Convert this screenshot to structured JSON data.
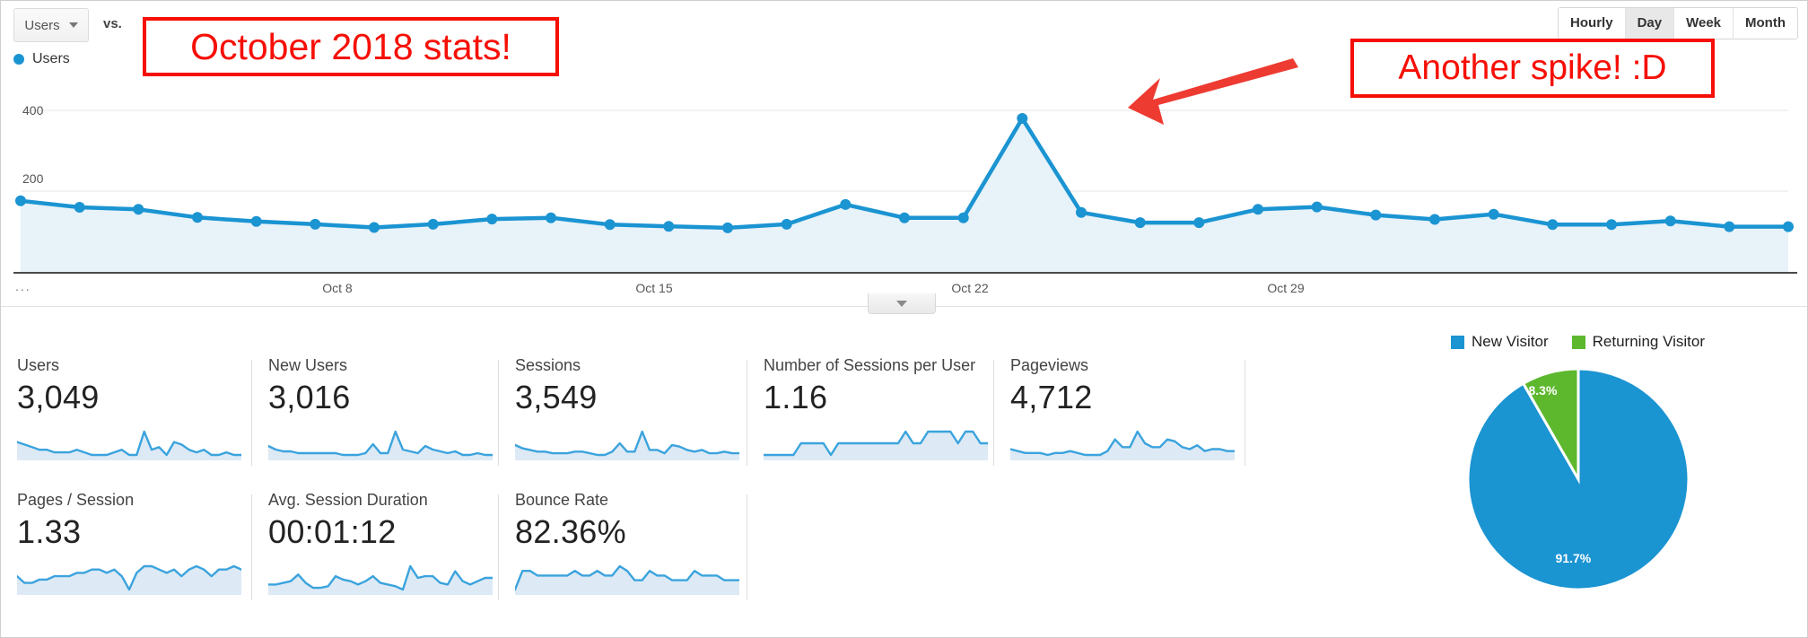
{
  "toolbar": {
    "metric_select_label": "Users",
    "metric_select_icon": "chevron-down-icon",
    "vs_label": "vs.",
    "granularity": [
      {
        "label": "Hourly",
        "selected": false
      },
      {
        "label": "Day",
        "selected": true
      },
      {
        "label": "Week",
        "selected": false
      },
      {
        "label": "Month",
        "selected": false
      }
    ]
  },
  "legend": {
    "series_label": "Users",
    "series_color": "#1b94d2"
  },
  "annotations": [
    {
      "text": "October 2018 stats!",
      "color": "#f60f06"
    },
    {
      "text": "Another spike! :D",
      "color": "#f60f06"
    }
  ],
  "chart_data": {
    "type": "area",
    "title": "",
    "xlabel": "",
    "ylabel": "Users",
    "ylim": [
      0,
      400
    ],
    "yticks": [
      "200",
      "400"
    ],
    "grid": true,
    "legend_position": "top-left",
    "x_tick_labels": [
      "...",
      "Oct 8",
      "Oct 15",
      "Oct 22",
      "Oct 29"
    ],
    "series": [
      {
        "name": "Users",
        "color": "#1b94d2",
        "values": [
          176,
          160,
          155,
          135,
          125,
          118,
          110,
          118,
          131,
          134,
          117,
          113,
          109,
          118,
          167,
          134,
          134,
          380,
          147,
          122,
          122,
          155,
          161,
          141,
          130,
          143,
          117,
          117,
          126,
          112,
          112
        ]
      }
    ],
    "collapse_toggle_icon": "chevron-down-icon"
  },
  "metric_cards": [
    [
      {
        "name": "Users",
        "value": "3,049",
        "spark": [
          22,
          21,
          20,
          19,
          19,
          18,
          18,
          18,
          19,
          18,
          17,
          17,
          17,
          18,
          19,
          17,
          17,
          26,
          19,
          20,
          17,
          22,
          21,
          19,
          18,
          19,
          17,
          17,
          18,
          17,
          17
        ]
      },
      {
        "name": "New Users",
        "value": "3,016",
        "spark": [
          22,
          20,
          19,
          19,
          18,
          18,
          18,
          18,
          18,
          18,
          17,
          17,
          17,
          18,
          23,
          18,
          18,
          30,
          20,
          19,
          18,
          22,
          20,
          19,
          18,
          19,
          17,
          17,
          18,
          17,
          17
        ]
      },
      {
        "name": "Sessions",
        "value": "3,549",
        "spark": [
          23,
          21,
          20,
          19,
          19,
          18,
          18,
          18,
          19,
          19,
          18,
          17,
          17,
          19,
          24,
          19,
          19,
          31,
          20,
          20,
          18,
          23,
          22,
          20,
          19,
          20,
          18,
          18,
          19,
          18,
          18
        ]
      },
      {
        "name": "Number of Sessions per User",
        "value": "1.16",
        "spark": [
          17,
          17,
          17,
          17,
          17,
          18,
          18,
          18,
          18,
          17,
          18,
          18,
          18,
          18,
          18,
          18,
          18,
          18,
          18,
          19,
          18,
          18,
          19,
          19,
          19,
          19,
          18,
          19,
          19,
          18,
          18
        ]
      },
      {
        "name": "Pageviews",
        "value": "4,712",
        "spark": [
          21,
          20,
          19,
          19,
          19,
          18,
          19,
          19,
          20,
          19,
          18,
          18,
          18,
          20,
          26,
          22,
          22,
          30,
          24,
          22,
          22,
          26,
          25,
          22,
          21,
          23,
          20,
          21,
          21,
          20,
          20
        ]
      }
    ],
    [
      {
        "name": "Pages / Session",
        "value": "1.33",
        "spark": [
          22,
          20,
          20,
          21,
          21,
          22,
          22,
          22,
          23,
          23,
          24,
          24,
          23,
          24,
          22,
          18,
          23,
          25,
          25,
          24,
          23,
          24,
          22,
          24,
          25,
          24,
          22,
          24,
          24,
          25,
          24
        ]
      },
      {
        "name": "Avg. Session Duration",
        "value": "00:01:12",
        "spark": [
          17,
          17,
          18,
          19,
          23,
          18,
          15,
          15,
          16,
          22,
          20,
          19,
          17,
          19,
          22,
          18,
          17,
          16,
          14,
          28,
          21,
          22,
          22,
          18,
          17,
          25,
          19,
          17,
          19,
          21,
          21
        ]
      },
      {
        "name": "Bounce Rate",
        "value": "82.36%",
        "spark": [
          19,
          23,
          23,
          22,
          22,
          22,
          22,
          22,
          23,
          22,
          22,
          23,
          22,
          22,
          24,
          23,
          21,
          21,
          23,
          22,
          22,
          21,
          21,
          21,
          23,
          22,
          22,
          22,
          21,
          21,
          21
        ]
      }
    ]
  ],
  "visitor_pie": {
    "type": "pie",
    "title": "",
    "legend_position": "top",
    "slices": [
      {
        "label": "New Visitor",
        "value": 91.7,
        "display": "91.7%",
        "color": "#1b94d2"
      },
      {
        "label": "Returning Visitor",
        "value": 8.3,
        "display": "8.3%",
        "color": "#5eb82e"
      }
    ]
  }
}
